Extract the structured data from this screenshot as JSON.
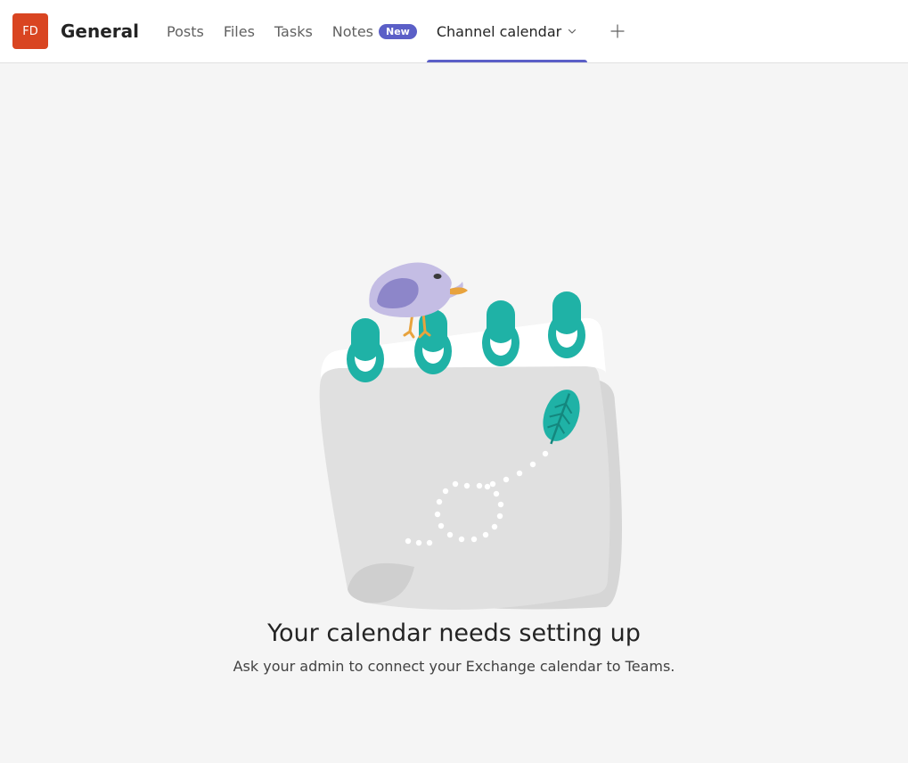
{
  "header": {
    "avatar_initials": "FD",
    "channel_title": "General",
    "tabs": [
      {
        "label": "Posts"
      },
      {
        "label": "Files"
      },
      {
        "label": "Tasks"
      },
      {
        "label": "Notes",
        "badge": "New"
      },
      {
        "label": "Channel calendar",
        "active": true,
        "dropdown": true
      }
    ]
  },
  "empty_state": {
    "title": "Your calendar needs setting up",
    "subtitle": "Ask your admin to connect your Exchange calendar to Teams."
  }
}
